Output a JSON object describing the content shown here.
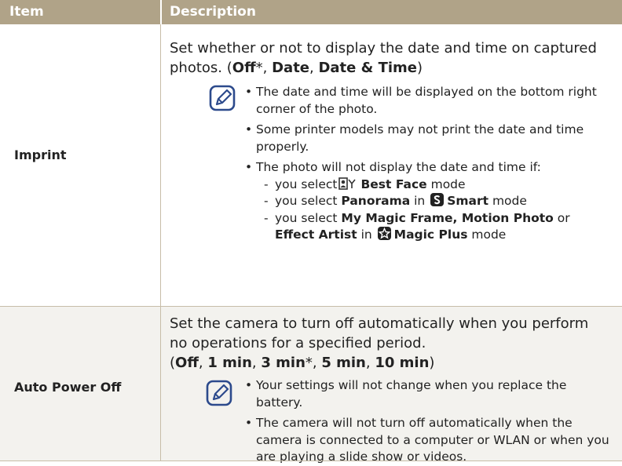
{
  "table": {
    "headers": {
      "item": "Item",
      "description": "Description"
    },
    "rows": [
      {
        "item": "Imprint",
        "intro": {
          "line1": "Set whether or not to display the date and time on captured",
          "line2_prefix": "photos. (",
          "off": "Off",
          "asterisk": "*",
          "sep1": ", ",
          "date": "Date",
          "sep2": ", ",
          "date_time": "Date & Time",
          "close": ")"
        },
        "notes": {
          "b1_l1": "The date and time will be displayed on the bottom right",
          "b1_l2": "corner of the photo.",
          "b2_l1": "Some printer models may not print the date and time",
          "b2_l2": "properly.",
          "b3": "The photo will not display the date and time if:",
          "d1_pre": "you select",
          "d1_mode": "Best Face",
          "d1_post": " mode",
          "d2_pre": "you select ",
          "d2_opt": "Panorama",
          "d2_mid": " in ",
          "d2_mode": "Smart",
          "d2_post": " mode",
          "d3_pre": "you select ",
          "d3_opts": "My Magic Frame, Motion Photo",
          "d3_or": " or",
          "d3_opt2": "Effect Artist",
          "d3_in": " in ",
          "d3_mode": "Magic Plus",
          "d3_post": " mode"
        }
      },
      {
        "item": "Auto Power Off",
        "intro": {
          "line1": "Set the camera to turn off automatically when you perform",
          "line2": "no operations for a specified period.",
          "open": "(",
          "off": "Off",
          "sep1": ", ",
          "min1": "1 min",
          "sep2": ", ",
          "min3": "3 min",
          "asterisk": "*",
          "sep3": ", ",
          "min5": "5 min",
          "sep4": ", ",
          "min10": "10 min",
          "close": ")"
        },
        "notes": {
          "b1_l1": "Your settings will not change when you replace the",
          "b1_l2": "battery.",
          "b2_l1": "The camera will not turn off automatically when the",
          "b2_l2": "camera is connected to a computer or WLAN or when you",
          "b2_l3": "are playing a slide show or videos."
        }
      }
    ]
  },
  "icons": {
    "note": "note-pencil-icon",
    "best_face": "best-face-mode-icon",
    "smart": "smart-mode-icon",
    "magic_plus": "magic-plus-mode-icon"
  },
  "colors": {
    "header_bg": "#b0a388",
    "row_alt_bg": "#f3f2ee",
    "rule": "#c7bda8",
    "icon_blue": "#2c4a8c"
  }
}
